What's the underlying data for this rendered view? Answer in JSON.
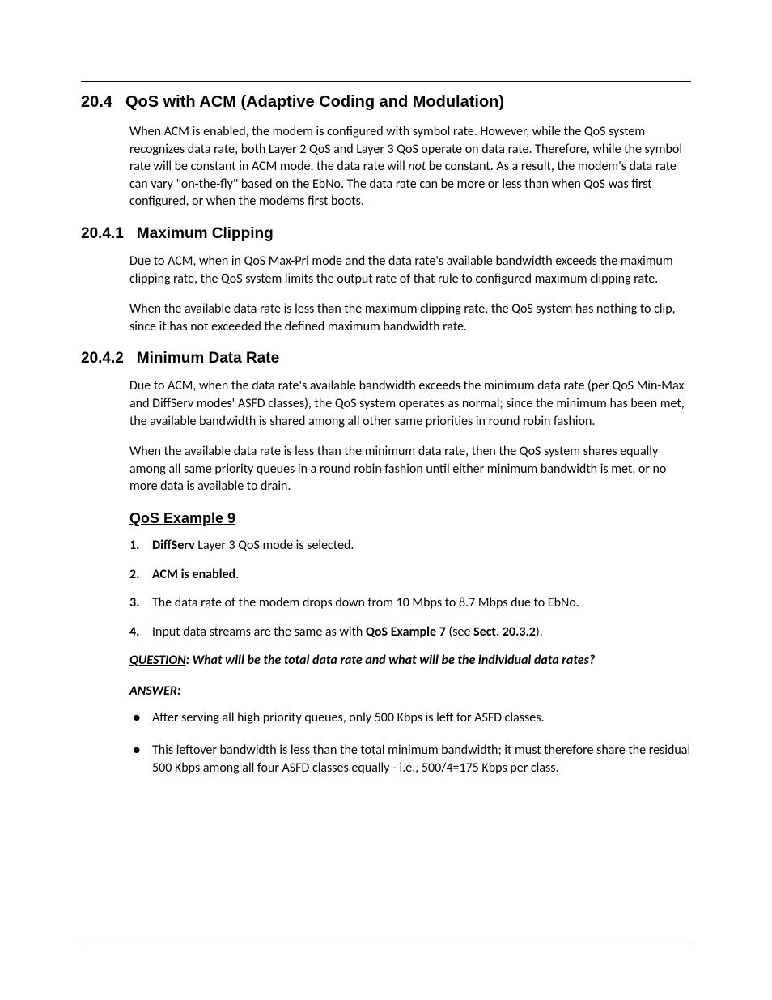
{
  "section": {
    "number": "20.4",
    "title": "QoS with ACM (Adaptive Coding and Modulation)",
    "para1_a": "When ACM is enabled, the modem is configured with symbol rate. However, while the QoS system recognizes data rate, both Layer 2 QoS and Layer 3 QoS operate on data rate. Therefore, while the symbol rate will be constant in ACM mode, the data rate will ",
    "para1_not": "not",
    "para1_b": " be constant. As a result, the modem's data rate can vary \"on-the-fly\" based on the EbNo. The data rate can be more or less than when QoS was first configured, or when the modems first boots."
  },
  "sub1": {
    "number": "20.4.1",
    "title": "Maximum Clipping",
    "para1": "Due to ACM, when in QoS Max-Pri mode and the data rate's available bandwidth exceeds the maximum clipping rate, the QoS system limits the output rate of that rule to configured maximum clipping rate.",
    "para2": "When the available data rate is less than the maximum clipping rate, the QoS system has nothing to clip, since it has not exceeded the defined maximum bandwidth rate."
  },
  "sub2": {
    "number": "20.4.2",
    "title": "Minimum Data Rate",
    "para1": "Due to ACM, when the data rate's available bandwidth exceeds the minimum data rate (per QoS Min-Max and DiffServ modes' ASFD classes), the QoS system operates as normal; since the minimum has been met, the available bandwidth is shared among all other same priorities in round robin fashion.",
    "para2": "When the available data rate is less than the minimum data rate, then the QoS system shares equally among all same priority queues in a round robin fashion until either minimum bandwidth is met, or no more data is available to drain."
  },
  "example": {
    "title": "QoS Example 9",
    "items": {
      "i1n": "1.",
      "i1_bold": "DiffServ",
      "i1_rest": " Layer 3 QoS mode is selected.",
      "i2n": "2.",
      "i2_bold": "ACM is enabled",
      "i2_rest": ".",
      "i3n": "3.",
      "i3": "The data rate of the modem drops down from 10 Mbps to 8.7 Mbps due to EbNo.",
      "i4n": "4.",
      "i4_a": "Input data streams are the same as with ",
      "i4_bold1": "QoS Example 7",
      "i4_b": " (see ",
      "i4_bold2": "Sect. 20.3.2",
      "i4_c": ")."
    },
    "question_label": "QUESTION",
    "question_text": ": What will be the total data rate and what will be the individual data rates?",
    "answer_label": "ANSWER",
    "answer_colon": ":",
    "answers": {
      "a1": "After serving all high priority queues, only 500 Kbps is left for ASFD classes.",
      "a2": "This leftover bandwidth is less than the total minimum bandwidth; it must therefore share the residual 500 Kbps among all four ASFD classes   equally - i.e., 500/4=175 Kbps per class."
    }
  }
}
